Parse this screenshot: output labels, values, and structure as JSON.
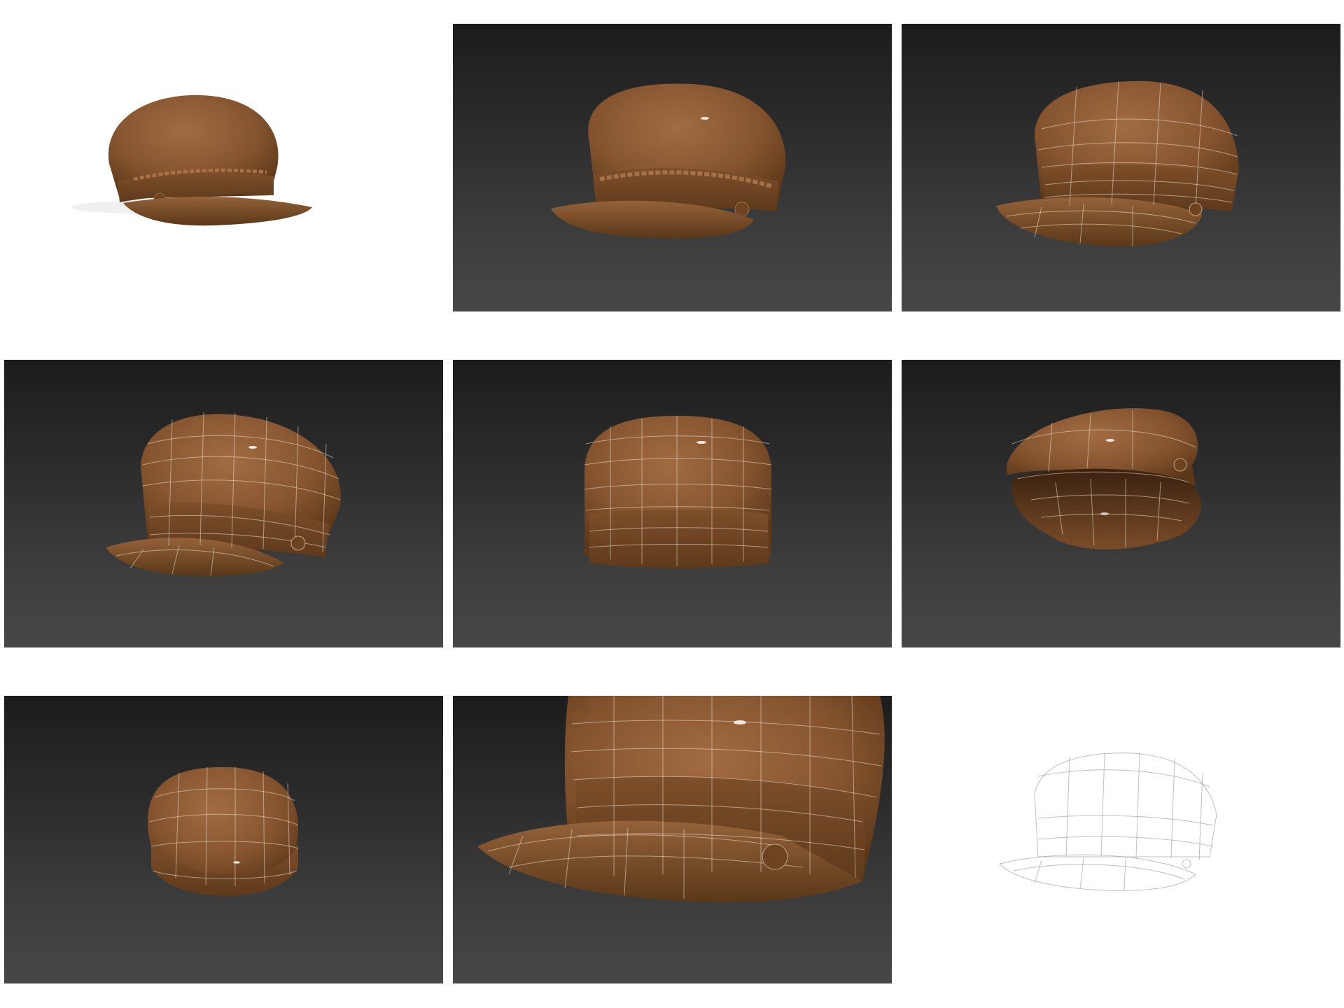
{
  "gallery": {
    "tiles": [
      {
        "view": "front-three-quarter",
        "style": "shaded",
        "background": "white"
      },
      {
        "view": "front-three-quarter",
        "style": "shaded",
        "background": "dark"
      },
      {
        "view": "front-three-quarter",
        "style": "shaded-wireframe",
        "background": "dark"
      },
      {
        "view": "side",
        "style": "shaded-wireframe",
        "background": "dark"
      },
      {
        "view": "back",
        "style": "shaded-wireframe",
        "background": "dark"
      },
      {
        "view": "underside",
        "style": "shaded-wireframe",
        "background": "dark"
      },
      {
        "view": "top",
        "style": "shaded-wireframe",
        "background": "dark"
      },
      {
        "view": "close-up",
        "style": "shaded-wireframe",
        "background": "dark"
      },
      {
        "view": "front-three-quarter",
        "style": "wireframe",
        "background": "white"
      }
    ]
  },
  "colors": {
    "hat": "#8a5a34",
    "hat_shadow": "#5a3618",
    "hat_highlight": "#a87248",
    "viewport_top": "#1c1c1c",
    "viewport_bottom": "#474747"
  }
}
